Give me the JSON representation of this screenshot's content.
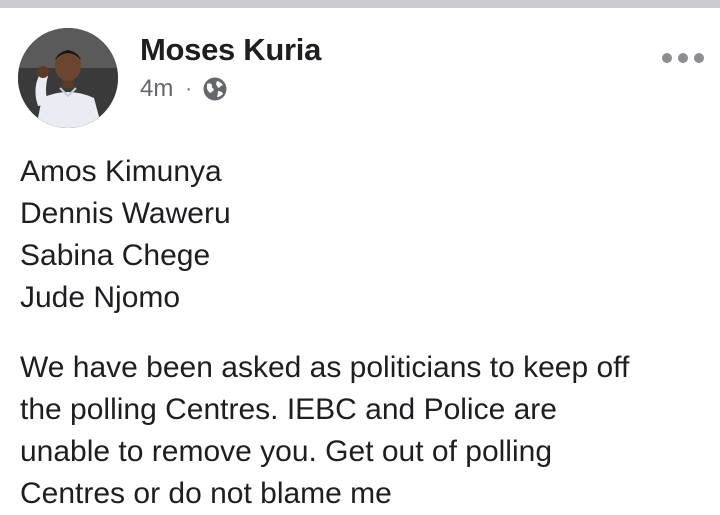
{
  "post": {
    "author": "Moses Kuria",
    "time": "4m",
    "separator": "·",
    "privacy_icon": "globe-icon",
    "more_icon": "more-horizontal-icon",
    "names": [
      "Amos Kimunya",
      "Dennis Waweru",
      "Sabina Chege",
      "Jude Njomo"
    ],
    "message_lines": [
      "We have been asked as politicians to keep off",
      "the polling Centres. IEBC and Police are",
      "unable to remove you. Get out of polling",
      "Centres or do not blame me"
    ]
  },
  "colors": {
    "text": "#1c1e21",
    "secondary": "#65676b",
    "top_bar": "#c9ccd1"
  }
}
